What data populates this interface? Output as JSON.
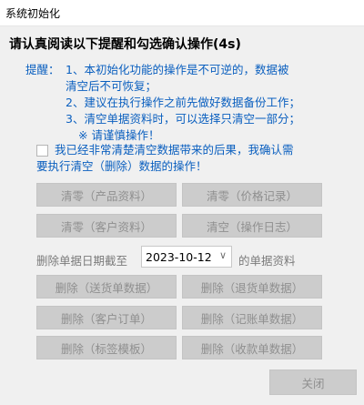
{
  "window": {
    "title": "系统初始化"
  },
  "heading": "请认真阅读以下提醒和勾选确认操作(4s)",
  "notice": {
    "label": "提醒：",
    "lines": [
      "1、本初始化功能的操作是不可逆的，数据被",
      "清空后不可恢复；",
      "2、建议在执行操作之前先做好数据备份工作；",
      "3、清空单据资料时，可以选择只清空一部分；",
      "※ 请谨慎操作！"
    ]
  },
  "consent": {
    "line1": "我已经非常清楚清空数据带来的后果，我确认需",
    "line2": "要执行清空（删除）数据的操作！",
    "checked": false
  },
  "clear_buttons": [
    "清零（产品资料）",
    "清零（价格记录）",
    "清零（客户资料）",
    "清空（操作日志）"
  ],
  "date_row": {
    "prefix": "删除单据日期截至",
    "date": "2023-10-12",
    "suffix": "的单据资料"
  },
  "delete_buttons": [
    "删除（送货单数据）",
    "删除（退货单数据）",
    "删除（客户订单）",
    "删除（记账单数据）",
    "删除（标签模板）",
    "删除（收款单数据）"
  ],
  "close_label": "关闭",
  "colors": {
    "notice_text": "#0a5fbf",
    "disabled_button": "#cccccc",
    "disabled_text": "#8f8f8f"
  }
}
